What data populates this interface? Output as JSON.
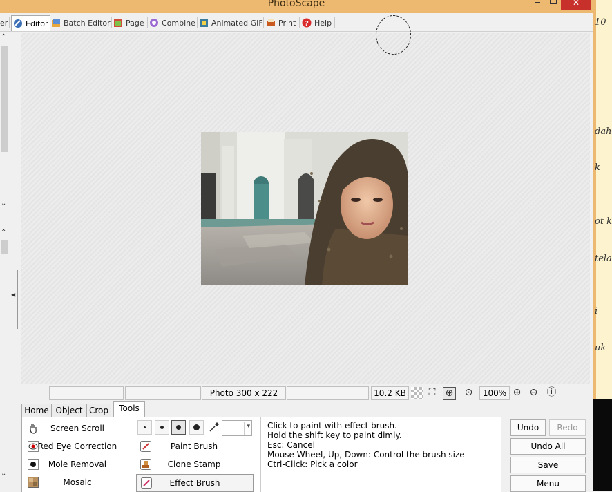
{
  "window": {
    "title": "PhotoScape",
    "close_symbol": "✕"
  },
  "tabs": [
    {
      "label": "er",
      "icon": "viewer-icon"
    },
    {
      "label": "Editor",
      "icon": "editor-icon"
    },
    {
      "label": "Batch Editor",
      "icon": "batch-editor-icon"
    },
    {
      "label": "Page",
      "icon": "page-icon"
    },
    {
      "label": "Combine",
      "icon": "combine-icon"
    },
    {
      "label": "Animated GIF",
      "icon": "animated-gif-icon"
    },
    {
      "label": "Print",
      "icon": "print-icon"
    },
    {
      "label": "Help",
      "icon": "help-icon"
    }
  ],
  "status": {
    "photo_info": "Photo 300 x 222",
    "file_size": "10.2 KB",
    "zoom": "100%"
  },
  "bottom_tabs": [
    "Home",
    "Object",
    "Crop",
    "Tools"
  ],
  "tools": {
    "left": [
      "Screen Scroll",
      "Red Eye Correction",
      "Mole Removal",
      "Mosaic"
    ],
    "brushes": [
      "Paint Brush",
      "Clone Stamp",
      "Effect Brush"
    ],
    "selected": "Effect Brush"
  },
  "help_text": "Click to paint with effect brush.\nHold the shift key to paint dimly.\nEsc: Cancel\nMouse Wheel, Up, Down: Control the brush size\nCtrl-Click: Pick a color",
  "actions": {
    "undo": "Undo",
    "redo": "Redo",
    "undo_all": "Undo All",
    "save": "Save",
    "menu": "Menu"
  },
  "side_text": [
    "10",
    "dah",
    "k",
    "ot k",
    "tela",
    "i",
    "uk"
  ],
  "colors": {
    "titlebar": "#edb870",
    "close": "#c7302b"
  }
}
